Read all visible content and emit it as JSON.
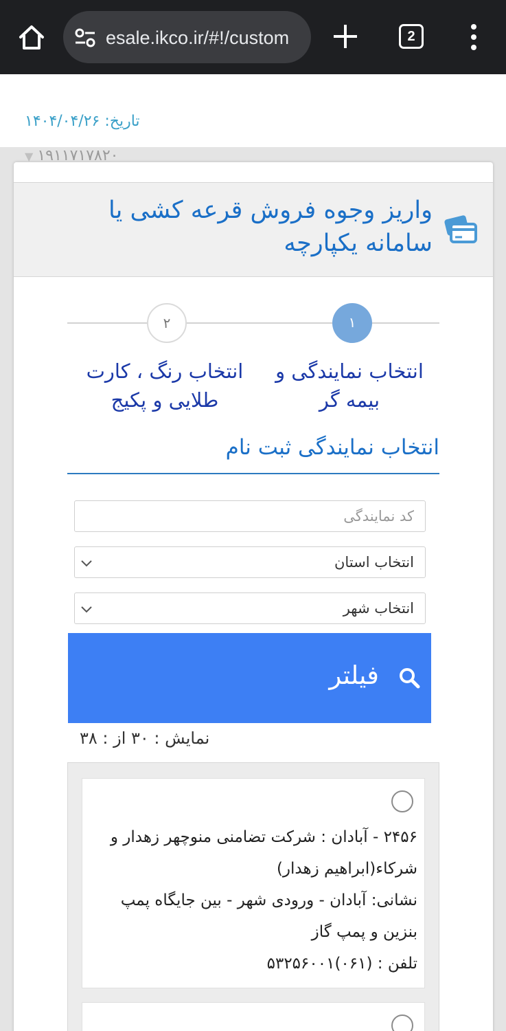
{
  "browser": {
    "url": "esale.ikco.ir/#!/custom",
    "tab_count": "2",
    "icons": [
      "home-icon",
      "site-settings-icon",
      "new-tab-icon",
      "tab-switcher-icon",
      "menu-icon"
    ]
  },
  "header": {
    "date": "تاریخ: ۱۴۰۴/۰۴/۲۶",
    "account": "۱۹۱۱۷۱۷۸۲۰"
  },
  "card": {
    "title": "واریز وجوه فروش قرعه کشی یا سامانه یکپارچه",
    "steps": [
      {
        "number": "۱",
        "label": "انتخاب نمایندگی و بیمه گر",
        "active": true
      },
      {
        "number": "۲",
        "label": "انتخاب رنگ ، کارت طلایی و پکیج",
        "active": false
      }
    ],
    "section_title": "انتخاب نمایندگی ثبت نام"
  },
  "form": {
    "dealer_code_placeholder": "کد نمایندگی",
    "province_selected": "انتخاب استان",
    "city_selected": "انتخاب شهر",
    "filter_label": "فیلتر"
  },
  "results": {
    "count_text": "نمایش : ۳۰ از : ۳۸",
    "items": [
      {
        "title": "۲۴۵۶ - آبادان : شرکت تضامنی منوچهر زهدار و شرکاء(ابراهیم زهدار)",
        "address": "نشانی: آبادان - ورودی شهر - بین جایگاه پمپ بنزین و پمپ گاز",
        "phone": "تلفن : (۰۶۱)۵۳۲۵۶۰۰۱"
      }
    ]
  },
  "colors": {
    "accent_blue": "#1a6fc7",
    "filter_button": "#3d7ff4",
    "step_active": "#76a8dc",
    "date_color": "#3aa0c8"
  }
}
